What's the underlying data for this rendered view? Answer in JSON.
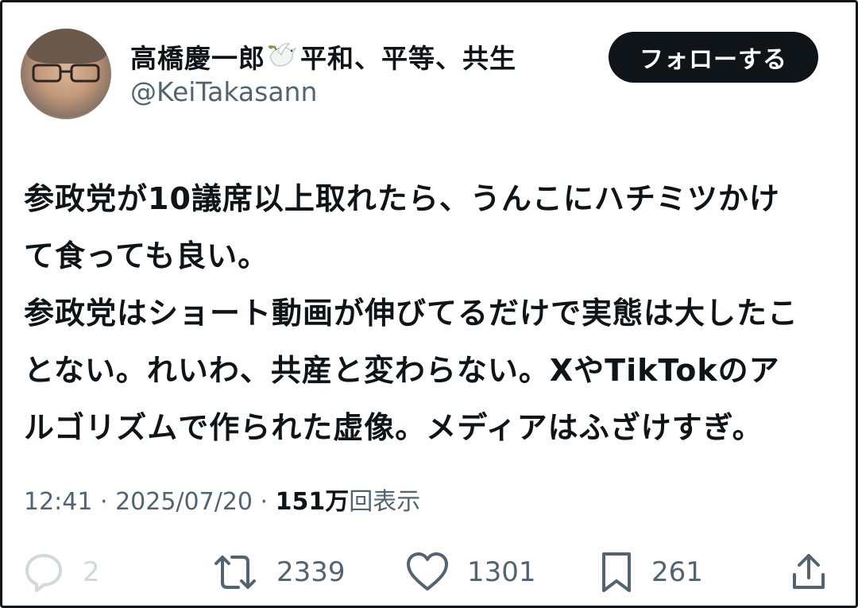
{
  "user": {
    "name": "高橋慶一郎",
    "name_suffix": "平和、平等、共生",
    "handle": "@KeiTakasann",
    "dove_icon": "dove-icon",
    "avatar_icon": "avatar-photo"
  },
  "follow_button": {
    "label": "フォローする"
  },
  "tweet": {
    "lines": [
      "参政党が10議席以上取れたら、うんこにハチミツかけ",
      "て食っても良い。",
      "参政党はショート動画が伸びてるだけで実態は大したこ",
      "とない。れいわ、共産と変わらない。XやTikTokのア",
      "ルゴリズムで作られた虚像。メディアはふざけすぎ。"
    ]
  },
  "meta": {
    "time": "12:41",
    "separator": " · ",
    "date": "2025/07/20",
    "views": "151万",
    "views_label": "回表示"
  },
  "actions": {
    "reply": {
      "icon": "reply-icon",
      "count": "2"
    },
    "retweet": {
      "icon": "retweet-icon",
      "count": "2339"
    },
    "like": {
      "icon": "heart-icon",
      "count": "1301"
    },
    "bookmark": {
      "icon": "bookmark-icon",
      "count": "261"
    },
    "share": {
      "icon": "share-icon"
    }
  },
  "colors": {
    "text": "#0f1419",
    "secondary": "#536471",
    "disabled": "#cfd9de",
    "button_bg": "#0f1419",
    "button_text": "#ffffff"
  }
}
